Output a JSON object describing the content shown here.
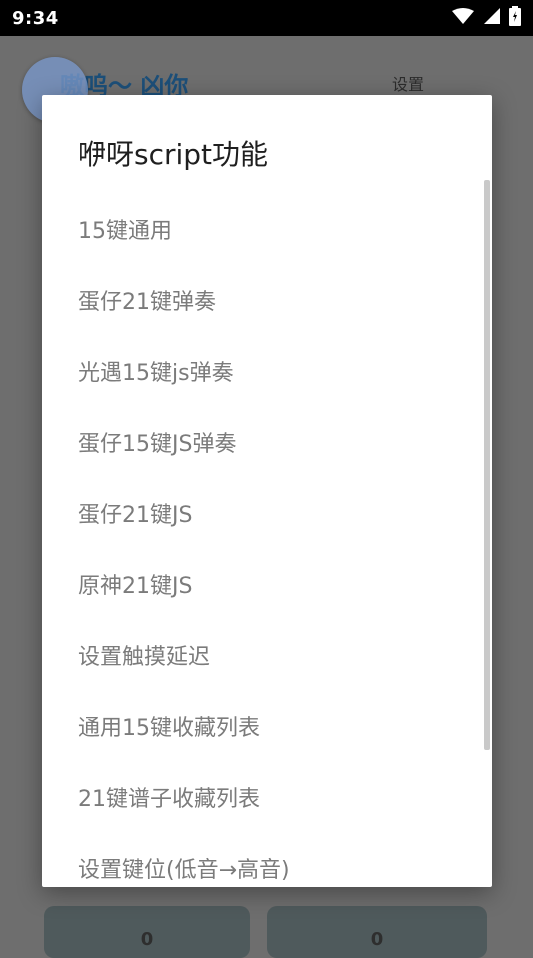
{
  "status_bar": {
    "time": "9:34",
    "icons": [
      "wifi-icon",
      "signal-icon",
      "battery-icon"
    ]
  },
  "background_app": {
    "title": "嗷呜～ 凶你",
    "settings_label": "设置",
    "cards": [
      "0",
      "0"
    ]
  },
  "dialog": {
    "title": "咿呀script功能",
    "items": [
      "15键通用",
      "蛋仔21键弹奏",
      "光遇15键js弹奏",
      "蛋仔15键JS弹奏",
      "蛋仔21键JS",
      "原神21键JS",
      "设置触摸延迟",
      "通用15键收藏列表",
      "21键谱子收藏列表",
      "设置键位(低音→高音)"
    ]
  },
  "colors": {
    "overlay": "#6e6e6e",
    "dialog_bg": "#ffffff",
    "item_text": "#7b7b7b",
    "title_text": "#1f1f1f",
    "accent_title": "#1c4f79"
  }
}
